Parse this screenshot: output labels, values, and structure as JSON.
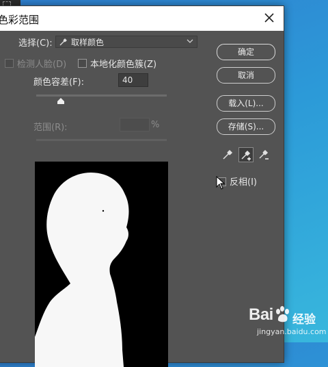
{
  "dialog": {
    "title": "色彩范围",
    "select": {
      "label": "选择(C):",
      "value": "取样颜色"
    },
    "detect_faces": {
      "label": "检测人脸(D)",
      "checked": false,
      "enabled": false
    },
    "localized_clusters": {
      "label": "本地化颜色簇(Z)",
      "checked": false
    },
    "fuzziness": {
      "label": "颜色容差(F):",
      "value": "40",
      "slider_fraction": 0.19
    },
    "range": {
      "label": "范围(R):",
      "value": "",
      "unit": "%",
      "enabled": false
    },
    "buttons": {
      "ok": "确定",
      "cancel": "取消",
      "load": "载入(L)...",
      "save": "存储(S)..."
    },
    "eyedroppers": [
      "eyedropper-icon",
      "eyedropper-plus-icon",
      "eyedropper-minus-icon"
    ],
    "invert": {
      "label": "反相(I)",
      "checked": false
    }
  },
  "watermark": {
    "brand": "Bai",
    "brand_cn": "经验",
    "url": "jingyan.baidu.com"
  },
  "colors": {
    "dialog_bg": "#535353",
    "title_bar": "#ffffff",
    "desktop": "#2c9ad8"
  }
}
